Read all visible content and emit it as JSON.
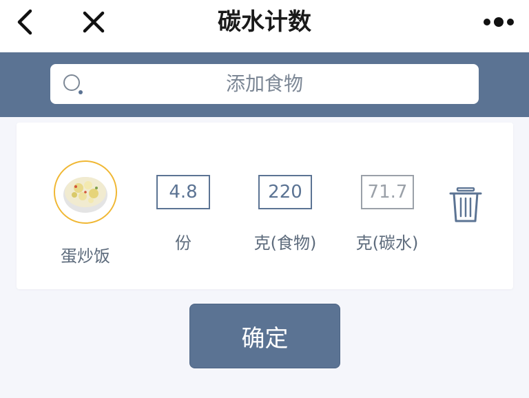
{
  "header": {
    "title": "碳水计数",
    "back_icon": "chevron-left-icon",
    "close_icon": "close-icon",
    "more_icon": "more-dots-icon"
  },
  "search": {
    "placeholder": "添加食物",
    "icon": "search-icon"
  },
  "food_item": {
    "name": "蛋炒饭",
    "servings": "4.8",
    "servings_unit": "份",
    "food_grams": "220",
    "food_grams_unit": "克(食物)",
    "carb_grams": "71.7",
    "carb_grams_unit": "克(碳水)",
    "delete_icon": "trash-icon",
    "image_icon": "food-bowl-image"
  },
  "actions": {
    "confirm_label": "确定"
  },
  "colors": {
    "accent": "#5b7393",
    "image_ring": "#f0b733",
    "background": "#f5f6fb"
  }
}
